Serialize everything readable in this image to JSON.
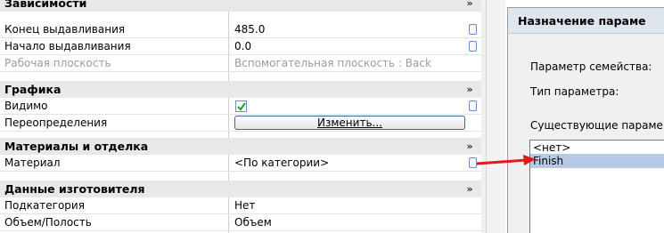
{
  "properties": {
    "groups": [
      {
        "title": "Зависимости",
        "collapse_glyph": "»"
      },
      {
        "title": "Графика",
        "collapse_glyph": "»"
      },
      {
        "title": "Материалы и отделка",
        "collapse_glyph": "»"
      },
      {
        "title": "Данные изготовителя",
        "collapse_glyph": "»"
      }
    ],
    "rows": {
      "extrusion_end": {
        "label": "Конец выдавливания",
        "value": "485.0"
      },
      "extrusion_start": {
        "label": "Начало выдавливания",
        "value": "0.0"
      },
      "work_plane": {
        "label": "Рабочая плоскость",
        "value": "Вспомогательная плоскость : Back"
      },
      "visible": {
        "label": "Видимо",
        "checked": true
      },
      "overrides": {
        "label": "Переопределения",
        "button": "Изменить..."
      },
      "material": {
        "label": "Материал",
        "value": "<По категории>"
      },
      "subcategory": {
        "label": "Подкатегория",
        "value": "Нет"
      },
      "solid_void": {
        "label": "Объем/Полость",
        "value": "Объем"
      }
    }
  },
  "dialog": {
    "title": "Назначение параме",
    "family_param_label": "Параметр семейства:",
    "param_type_label": "Тип параметра:",
    "existing_params_label": "Существующие параме",
    "list_items": [
      "<нет>",
      "Finish"
    ],
    "selected_item": "Finish"
  },
  "colors": {
    "arrow": "#e8161c",
    "selection": "#b8c9e6",
    "group_header_bg": "#e8e8e8"
  }
}
